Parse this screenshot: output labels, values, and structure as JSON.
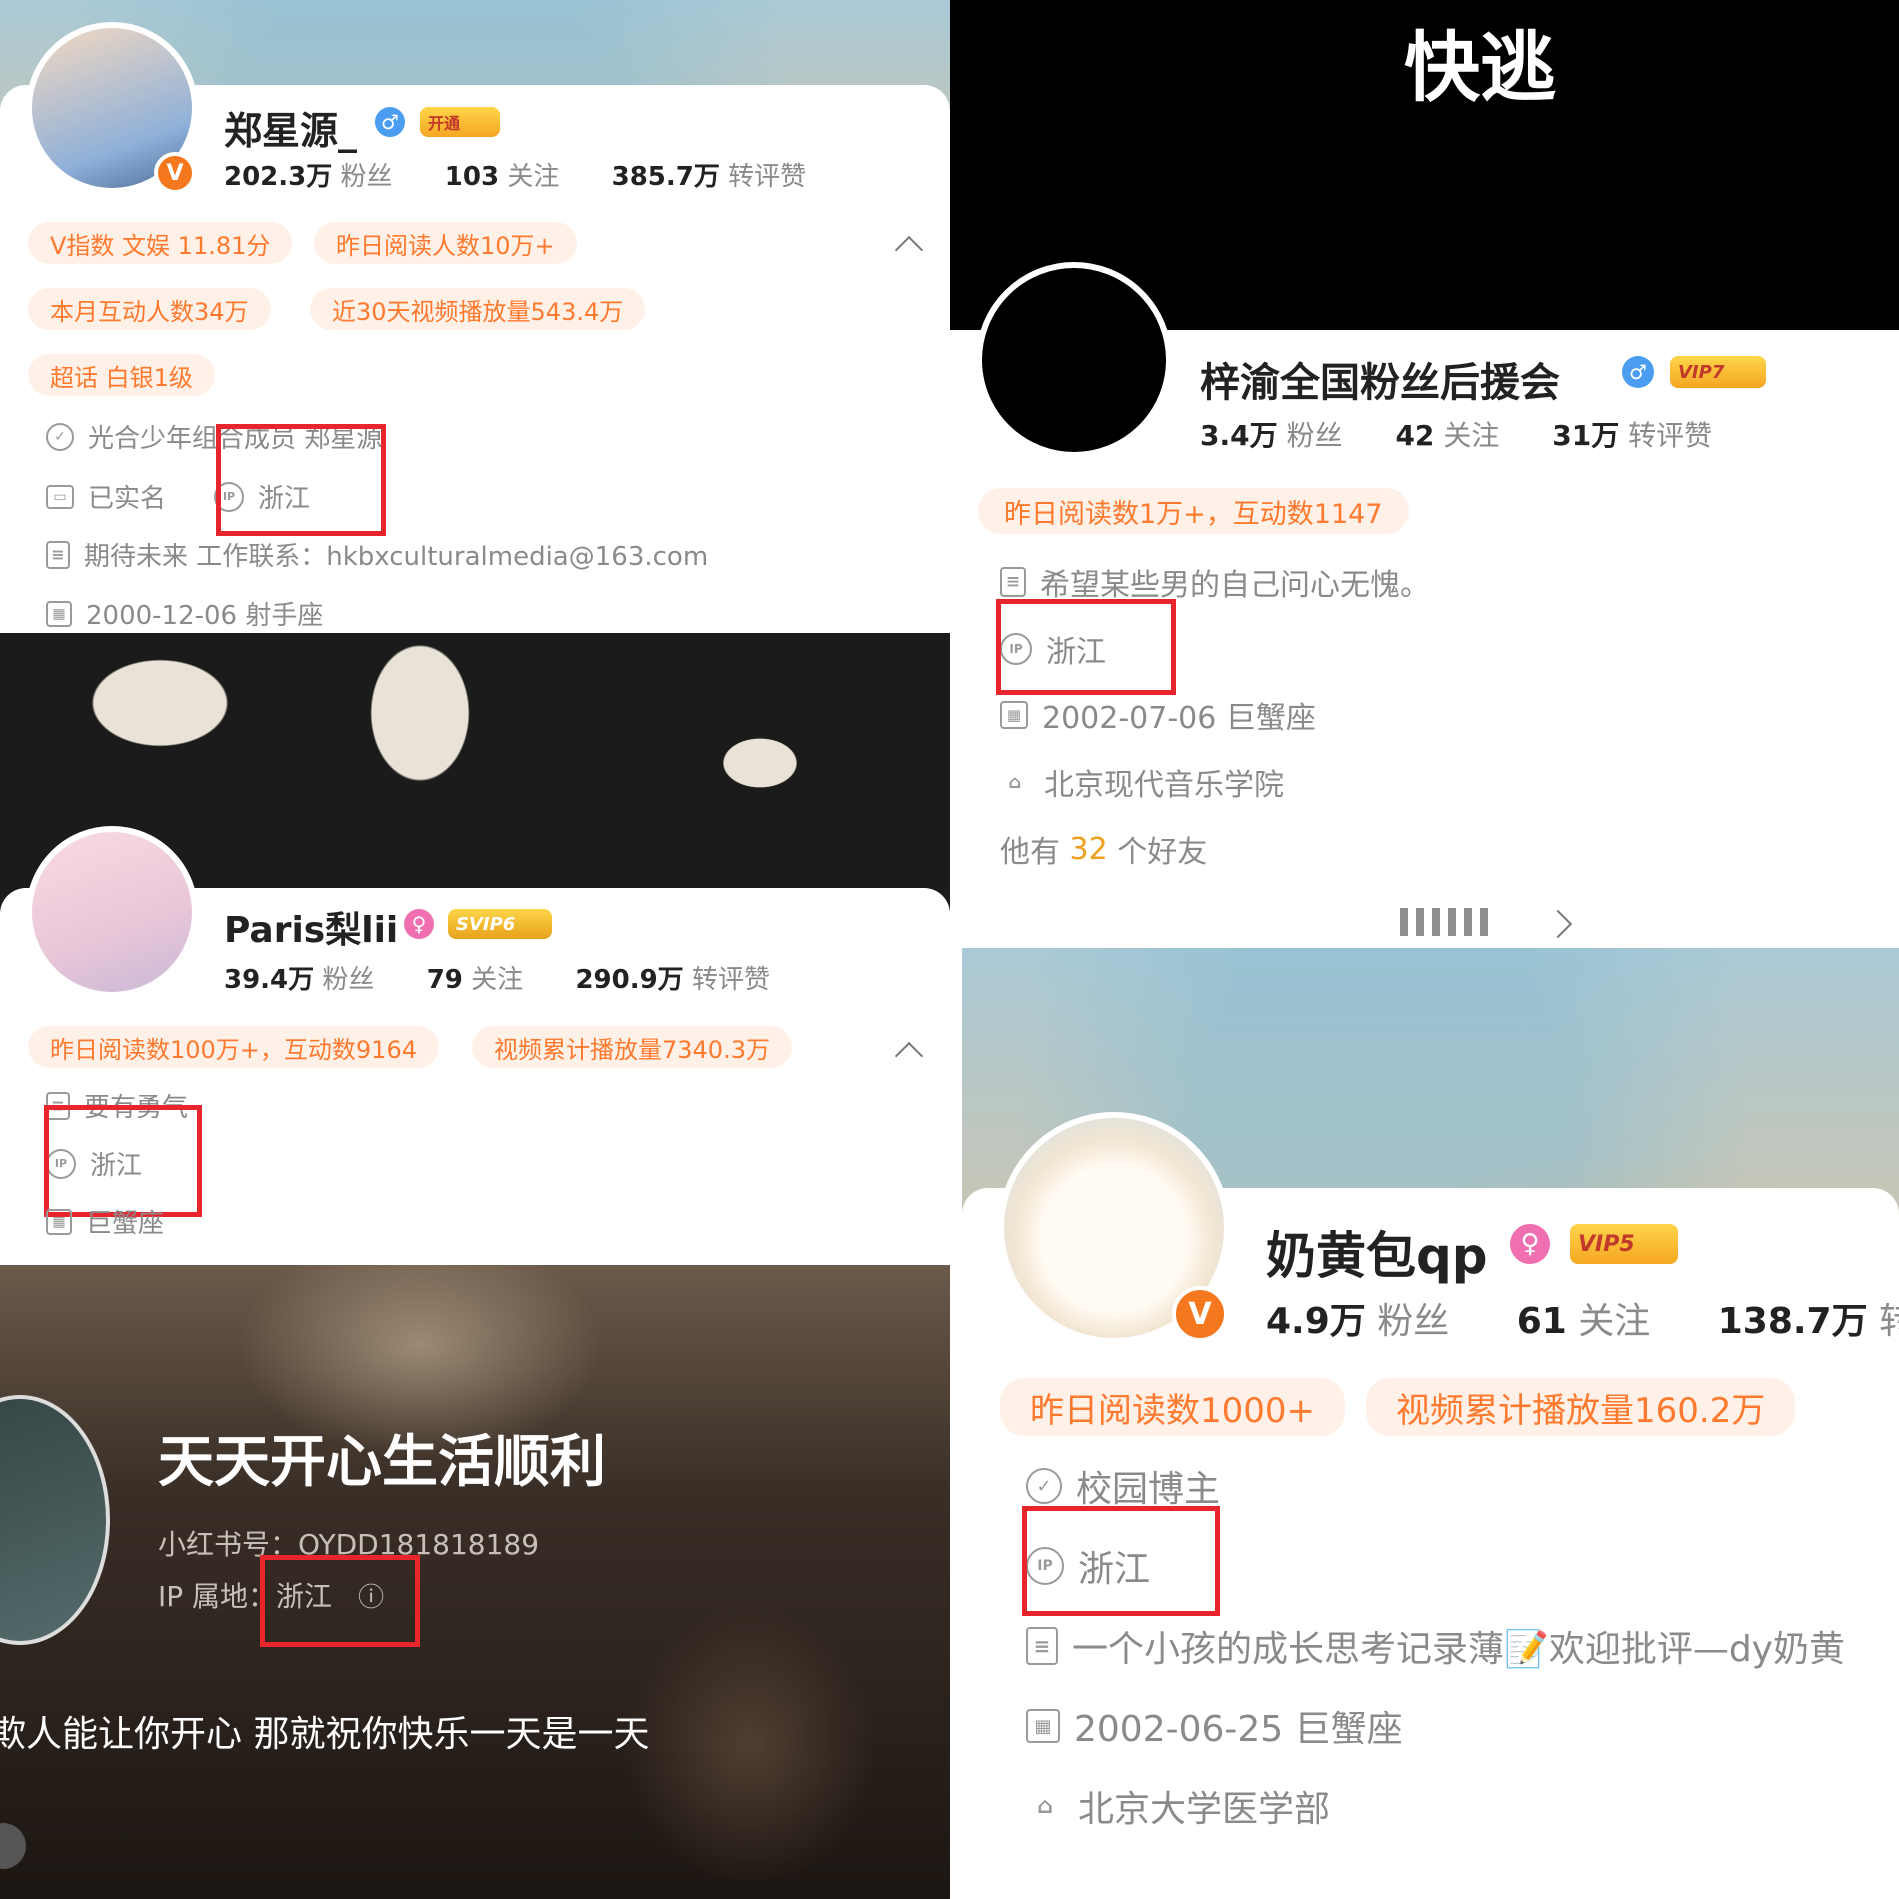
{
  "p1": {
    "name": "郑星源_",
    "gender": "♂",
    "vip_label": "开通",
    "avatar_badge": "V",
    "fans": "202.3万",
    "fans_label": "粉丝",
    "follow": "103",
    "follow_label": "关注",
    "likes": "385.7万",
    "likes_label": "转评赞",
    "tags": [
      "V指数 文娱 11.81分",
      "昨日阅读人数10万+",
      "本月互动人数34万",
      "近30天视频播放量543.4万",
      "超话 白银1级"
    ],
    "verified": "光合少年组合成员 郑星源",
    "realname": "已实名",
    "ip": "浙江",
    "bio": "期待未来 工作联系：hkbxculturalmedia@163.com",
    "birthday": "2000-12-06 射手座"
  },
  "p2": {
    "name": "Paris梨lii",
    "gender": "♀",
    "vip_label": "SVIP6",
    "fans": "39.4万",
    "fans_label": "粉丝",
    "follow": "79",
    "follow_label": "关注",
    "likes": "290.9万",
    "likes_label": "转评赞",
    "tags": [
      "昨日阅读数100万+，互动数9164",
      "视频累计播放量7340.3万"
    ],
    "bio": "要有勇气",
    "ip": "浙江",
    "birthday": "巨蟹座"
  },
  "p3": {
    "title": "天天开心生活顺利",
    "rednote_id": "小红书号：OYDD181818189",
    "ip_label": "IP 属地：",
    "ip": "浙江",
    "info_icon": "ⓘ",
    "caption": "欺人能让你开心 那就祝你快乐一天是一天"
  },
  "p4": {
    "banner_text": "快逃",
    "name": "梓渝全国粉丝后援会",
    "gender": "♂",
    "vip_label": "VIP7",
    "fans": "3.4万",
    "fans_label": "粉丝",
    "follow": "42",
    "follow_label": "关注",
    "likes": "31万",
    "likes_label": "转评赞",
    "tag": "昨日阅读数1万+，互动数1147",
    "bio": "希望某些男的自己问心无愧。",
    "ip": "浙江",
    "birthday": "2002-07-06 巨蟹座",
    "school": "北京现代音乐学院",
    "friends_pre": "他有",
    "friends_count": "32",
    "friends_post": "个好友"
  },
  "p5": {
    "name": "奶黄包qp",
    "gender": "♀",
    "vip_label": "VIP5",
    "avatar_badge": "V",
    "fans": "4.9万",
    "fans_label": "粉丝",
    "follow": "61",
    "follow_label": "关注",
    "likes": "138.7万",
    "likes_label": "转",
    "tags": [
      "昨日阅读数1000+",
      "视频累计播放量160.2万"
    ],
    "verified": "校园博主",
    "ip": "浙江",
    "bio": "一个小孩的成长思考记录薄📝欢迎批评—dy奶黄",
    "birthday": "2002-06-25 巨蟹座",
    "school": "北京大学医学部"
  },
  "icons": {
    "ip": "IP",
    "shield": "✓",
    "doc": "≡",
    "cal": "▦",
    "id": "▭",
    "school": "⌂"
  },
  "colors": {
    "accent_orange": "#ff7a2e",
    "highlight_red": "#e8242d",
    "male_blue": "#4a9df0",
    "female_pink": "#f06fb1"
  }
}
